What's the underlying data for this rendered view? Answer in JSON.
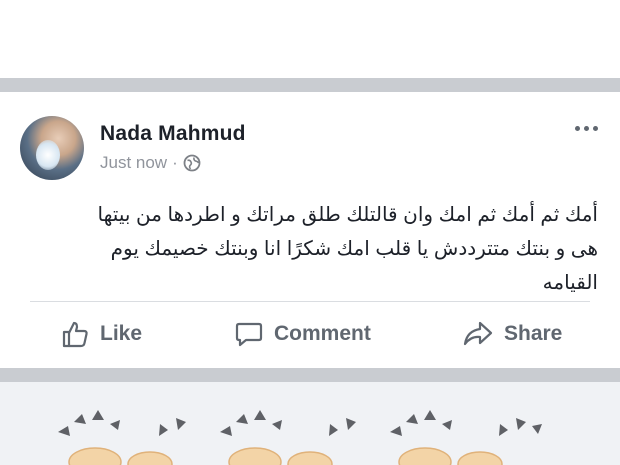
{
  "post": {
    "author": "Nada Mahmud",
    "time": "Just now",
    "separator": "·",
    "privacy_icon": "globe-icon",
    "text_lines": [
      "أمك ثم أمك ثم امك وان قالتلك طلق مراتك و  اطردها من بيتها",
      "هى و بنتك متترددش يا قلب امك  شكرًا انا وبنتك خصيمك يوم",
      "القيامه"
    ],
    "more_icon": "ellipsis-icon"
  },
  "actions": {
    "like": "Like",
    "comment": "Comment",
    "share": "Share"
  },
  "colors": {
    "background": "#e9ebee",
    "text": "#1d2129",
    "muted": "#90949c",
    "action": "#606770"
  }
}
